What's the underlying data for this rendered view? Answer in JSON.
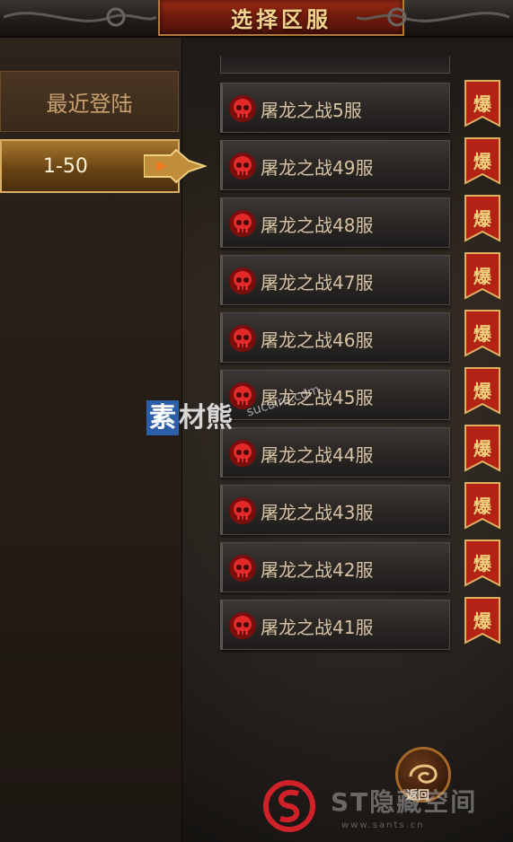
{
  "title": "选择区服",
  "tabs": {
    "recent_label": "最近登陆",
    "range_label": "1-50"
  },
  "servers": [
    {
      "name": "屠龙之战5服",
      "badge": "爆"
    },
    {
      "name": "屠龙之战49服",
      "badge": "爆"
    },
    {
      "name": "屠龙之战48服",
      "badge": "爆"
    },
    {
      "name": "屠龙之战47服",
      "badge": "爆"
    },
    {
      "name": "屠龙之战46服",
      "badge": "爆"
    },
    {
      "name": "屠龙之战45服",
      "badge": "爆"
    },
    {
      "name": "屠龙之战44服",
      "badge": "爆"
    },
    {
      "name": "屠龙之战43服",
      "badge": "爆"
    },
    {
      "name": "屠龙之战42服",
      "badge": "爆"
    },
    {
      "name": "屠龙之战41服",
      "badge": "爆"
    }
  ],
  "return_label": "返回",
  "watermark1": {
    "brand_blue": "素",
    "brand_rest": "材熊",
    "url": "sucaire.com"
  },
  "watermark2": {
    "text": "ST隐藏空间",
    "url": "www.sants.cn"
  },
  "colors": {
    "accent_gold": "#d9b063",
    "title_red": "#6e1a0c",
    "badge_red": "#b22316"
  },
  "icons": {
    "skull": "skull-icon",
    "arrow": "arrow-pointer-icon",
    "dragon": "dragon-icon"
  }
}
